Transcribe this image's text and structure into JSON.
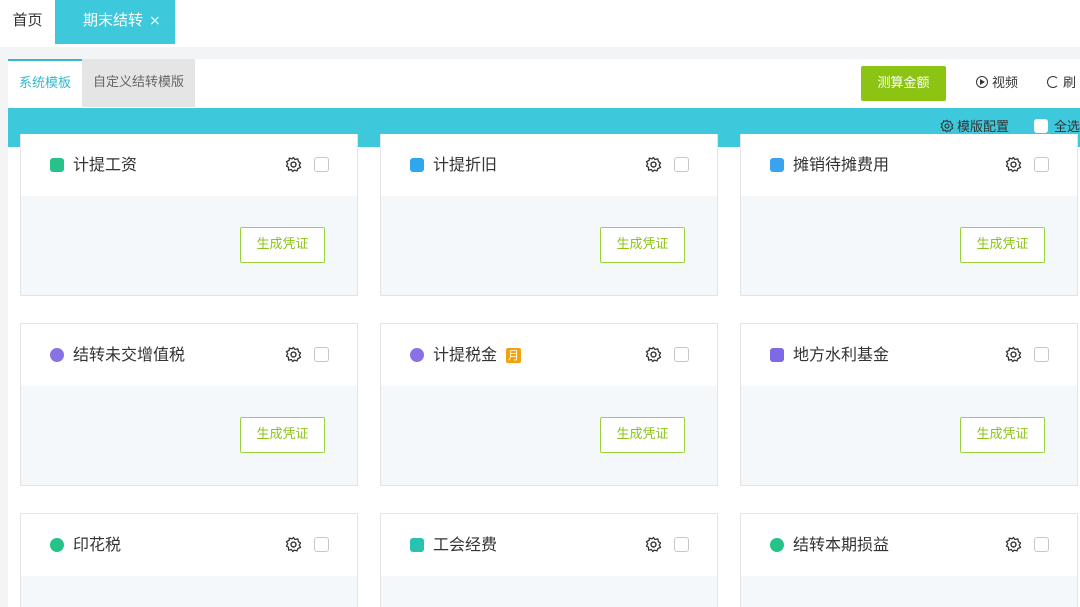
{
  "tabs": {
    "home": "首页",
    "active": "期末结转",
    "close": "×"
  },
  "subtabs": {
    "system": "系统模板",
    "custom": "自定义结转模版"
  },
  "toolbar": {
    "calc": "测算金额",
    "video": "视频",
    "refresh": "刷"
  },
  "bar": {
    "config": "模版配置",
    "select_all": "全选"
  },
  "cards": [
    {
      "title": "计提工资",
      "icon": "document-icon",
      "icon_color": "#27c28a",
      "button": "生成凭证"
    },
    {
      "title": "计提折旧",
      "icon": "document-icon",
      "icon_color": "#2fa7ee",
      "button": "生成凭证"
    },
    {
      "title": "摊销待摊费用",
      "icon": "grid-icon",
      "icon_color": "#3aa3f0",
      "button": "生成凭证"
    },
    {
      "title": "结转未交增值税",
      "icon": "money-bag-icon",
      "icon_color": "#8a72e6",
      "button": "生成凭证"
    },
    {
      "title": "计提税金",
      "icon": "coins-icon",
      "icon_color": "#8a72e6",
      "badge": "月",
      "button": "生成凭证"
    },
    {
      "title": "地方水利基金",
      "icon": "square-icon",
      "icon_color": "#7c6ae6",
      "button": "生成凭证"
    },
    {
      "title": "印花税",
      "icon": "coin-stack-icon",
      "icon_color": "#27c28a",
      "button": ""
    },
    {
      "title": "工会经费",
      "icon": "union-icon",
      "icon_color": "#27c2b0",
      "button": ""
    },
    {
      "title": "结转本期损益",
      "icon": "profit-bag-icon",
      "icon_color": "#27c28a",
      "button": ""
    }
  ],
  "colors": {
    "accent": "#3ec8dc",
    "green": "#8cc414"
  }
}
